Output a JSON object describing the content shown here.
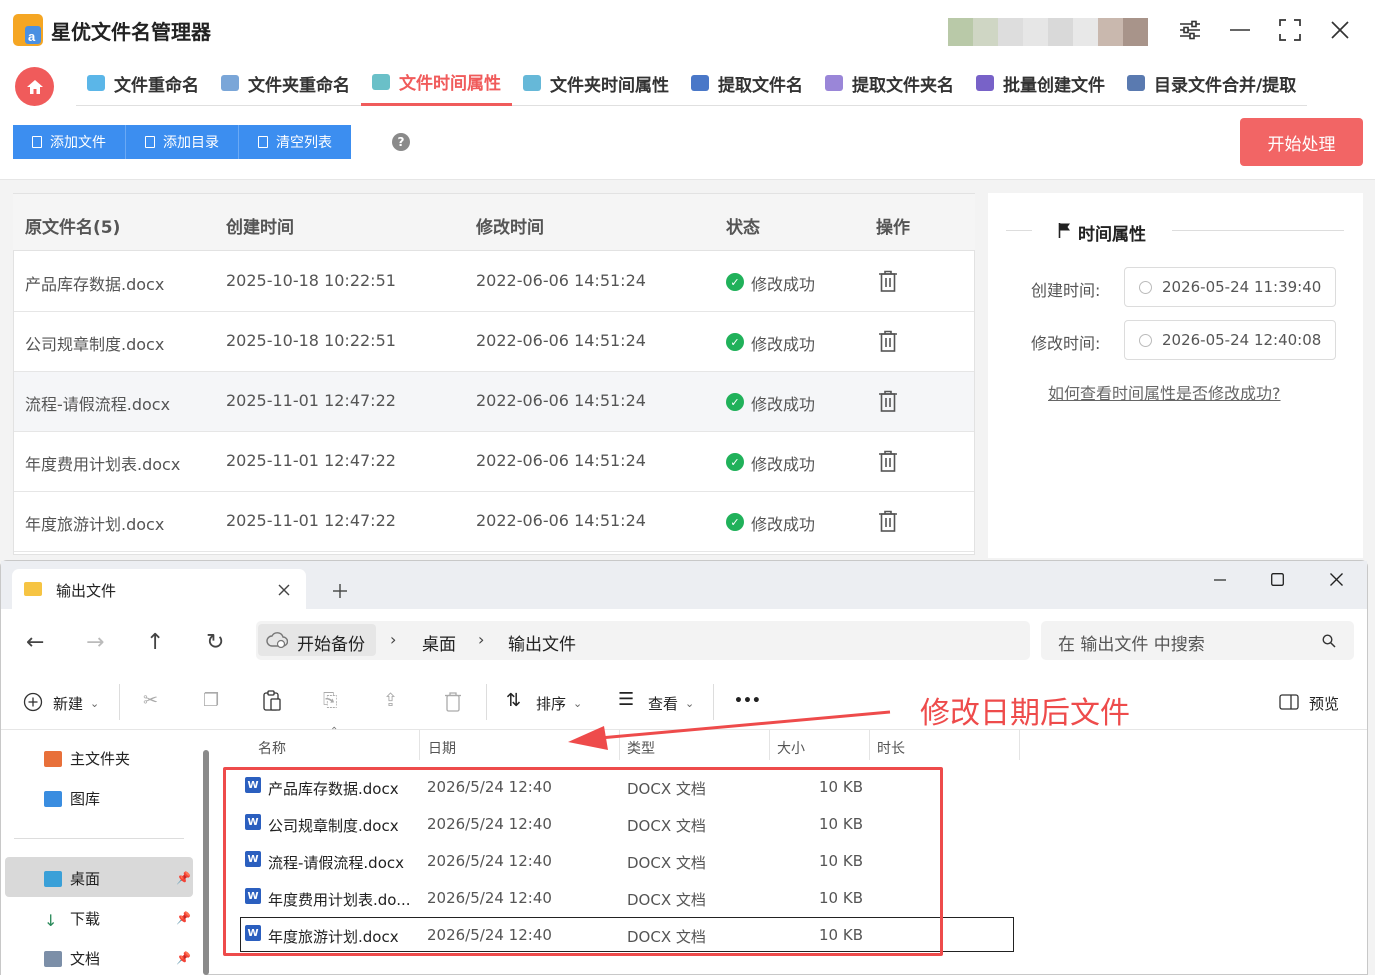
{
  "app": {
    "title": "星优文件名管理器"
  },
  "nav": {
    "tabs": [
      "文件重命名",
      "文件夹重命名",
      "文件时间属性",
      "文件夹时间属性",
      "提取文件名",
      "提取文件夹名",
      "批量创建文件",
      "目录文件合并/提取"
    ],
    "active": 2
  },
  "toolbar": {
    "add_file": "添加文件",
    "add_dir": "添加目录",
    "clear_list": "清空列表",
    "help": "?",
    "start": "开始处理"
  },
  "table": {
    "headers": [
      "原文件名(5)",
      "创建时间",
      "修改时间",
      "状态",
      "操作"
    ],
    "rows": [
      {
        "name": "产品库存数据.docx",
        "created": "2025-10-18 10:22:51",
        "modified": "2022-06-06 14:51:24",
        "status": "修改成功"
      },
      {
        "name": "公司规章制度.docx",
        "created": "2025-10-18 10:22:51",
        "modified": "2022-06-06 14:51:24",
        "status": "修改成功"
      },
      {
        "name": "流程-请假流程.docx",
        "created": "2025-11-01 12:47:22",
        "modified": "2022-06-06 14:51:24",
        "status": "修改成功"
      },
      {
        "name": "年度费用计划表.docx",
        "created": "2025-11-01 12:47:22",
        "modified": "2022-06-06 14:51:24",
        "status": "修改成功"
      },
      {
        "name": "年度旅游计划.docx",
        "created": "2025-11-01 12:47:22",
        "modified": "2022-06-06 14:51:24",
        "status": "修改成功"
      }
    ]
  },
  "panel": {
    "title": "时间属性",
    "created_label": "创建时间:",
    "created_value": "2026-05-24 11:39:40",
    "modified_label": "修改时间:",
    "modified_value": "2026-05-24 12:40:08",
    "help_link": "如何查看时间属性是否修改成功?"
  },
  "explorer": {
    "tab_title": "输出文件",
    "breadcrumb": [
      "开始备份",
      "桌面",
      "输出文件"
    ],
    "search_placeholder": "在 输出文件 中搜索",
    "commands": {
      "new": "新建",
      "sort": "排序",
      "view": "查看",
      "more": "•••",
      "preview": "预览"
    },
    "sidebar": [
      "主文件夹",
      "图库",
      "桌面",
      "下载",
      "文档"
    ],
    "columns": [
      "名称",
      "日期",
      "类型",
      "大小",
      "时长"
    ],
    "files": [
      {
        "name": "产品库存数据.docx",
        "date": "2026/5/24 12:40",
        "type": "DOCX 文档",
        "size": "10 KB"
      },
      {
        "name": "公司规章制度.docx",
        "date": "2026/5/24 12:40",
        "type": "DOCX 文档",
        "size": "10 KB"
      },
      {
        "name": "流程-请假流程.docx",
        "date": "2026/5/24 12:40",
        "type": "DOCX 文档",
        "size": "10 KB"
      },
      {
        "name": "年度费用计划表.do...",
        "date": "2026/5/24 12:40",
        "type": "DOCX 文档",
        "size": "10 KB"
      },
      {
        "name": "年度旅游计划.docx",
        "date": "2026/5/24 12:40",
        "type": "DOCX 文档",
        "size": "10 KB"
      }
    ]
  },
  "annotation": {
    "text": "修改日期后文件"
  },
  "colors": {
    "accent": "#f05b5b",
    "primary_button": "#3c8ef0",
    "success": "#20b15a",
    "annotation": "#ee4b4b"
  }
}
